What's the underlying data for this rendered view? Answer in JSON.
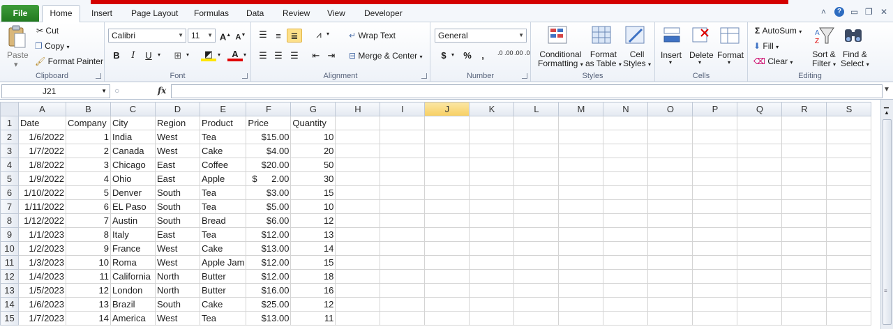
{
  "tabs": {
    "file": "File",
    "items": [
      "Home",
      "Insert",
      "Page Layout",
      "Formulas",
      "Data",
      "Review",
      "View",
      "Developer"
    ]
  },
  "ribbon": {
    "clipboard": {
      "label": "Clipboard",
      "paste": "Paste",
      "cut": "Cut",
      "copy": "Copy",
      "format_painter": "Format Painter"
    },
    "font": {
      "label": "Font",
      "name": "Calibri",
      "size": "11",
      "bold": "B",
      "italic": "I",
      "underline": "U"
    },
    "alignment": {
      "label": "Alignment",
      "wrap": "Wrap Text",
      "merge": "Merge & Center"
    },
    "number": {
      "label": "Number",
      "format": "General",
      "currency": "$",
      "percent": "%",
      "comma": ",",
      "inc_decimal": ".0 .00",
      "dec_decimal": ".00 .0"
    },
    "styles": {
      "label": "Styles",
      "conditional": "Conditional",
      "conditional2": "Formatting",
      "format_table": "Format",
      "format_table2": "as Table",
      "cell_styles": "Cell",
      "cell_styles2": "Styles"
    },
    "cells": {
      "label": "Cells",
      "insert": "Insert",
      "delete": "Delete",
      "format": "Format"
    },
    "editing": {
      "label": "Editing",
      "autosum": "AutoSum",
      "fill": "Fill",
      "clear": "Clear",
      "sort": "Sort &",
      "sort2": "Filter",
      "find": "Find &",
      "find2": "Select"
    }
  },
  "formula_bar": {
    "name_box": "J21",
    "fx": "fx",
    "value": ""
  },
  "sheet": {
    "columns": [
      "A",
      "B",
      "C",
      "D",
      "E",
      "F",
      "G",
      "H",
      "I",
      "J",
      "K",
      "L",
      "M",
      "N",
      "O",
      "P",
      "Q",
      "R",
      "S"
    ],
    "selected_column": "J",
    "rows": [
      [
        "1",
        "Date",
        "Company",
        "City",
        "Region",
        "Product",
        "Price",
        "Quantity"
      ],
      [
        "2",
        "1/6/2022",
        "1",
        "India",
        "West",
        "Tea",
        "$15.00",
        "10"
      ],
      [
        "3",
        "1/7/2022",
        "2",
        "Canada",
        "West",
        "Cake",
        "$4.00",
        "20"
      ],
      [
        "4",
        "1/8/2022",
        "3",
        "Chicago",
        "East",
        "Coffee",
        "$20.00",
        "50"
      ],
      [
        "5",
        "1/9/2022",
        "4",
        "Ohio",
        "East",
        "Apple",
        "2.00",
        "30"
      ],
      [
        "6",
        "1/10/2022",
        "5",
        "Denver",
        "South",
        "Tea",
        "$3.00",
        "15"
      ],
      [
        "7",
        "1/11/2022",
        "6",
        "EL Paso",
        "South",
        "Tea",
        "$5.00",
        "10"
      ],
      [
        "8",
        "1/12/2022",
        "7",
        "Austin",
        "South",
        "Bread",
        "$6.00",
        "12"
      ],
      [
        "9",
        "1/1/2023",
        "8",
        "Italy",
        "East",
        "Tea",
        "$12.00",
        "13"
      ],
      [
        "10",
        "1/2/2023",
        "9",
        "France",
        "West",
        "Cake",
        "$13.00",
        "14"
      ],
      [
        "11",
        "1/3/2023",
        "10",
        "Roma",
        "West",
        "Apple Jam",
        "$12.00",
        "15"
      ],
      [
        "12",
        "1/4/2023",
        "11",
        "California",
        "North",
        "Butter",
        "$12.00",
        "18"
      ],
      [
        "13",
        "1/5/2023",
        "12",
        "London",
        "North",
        "Butter",
        "$16.00",
        "16"
      ],
      [
        "14",
        "1/6/2023",
        "13",
        "Brazil",
        "South",
        "Cake",
        "$25.00",
        "12"
      ],
      [
        "15",
        "1/7/2023",
        "14",
        "America",
        "West",
        "Tea",
        "$13.00",
        "11"
      ]
    ],
    "accounting_symbol": "$"
  }
}
